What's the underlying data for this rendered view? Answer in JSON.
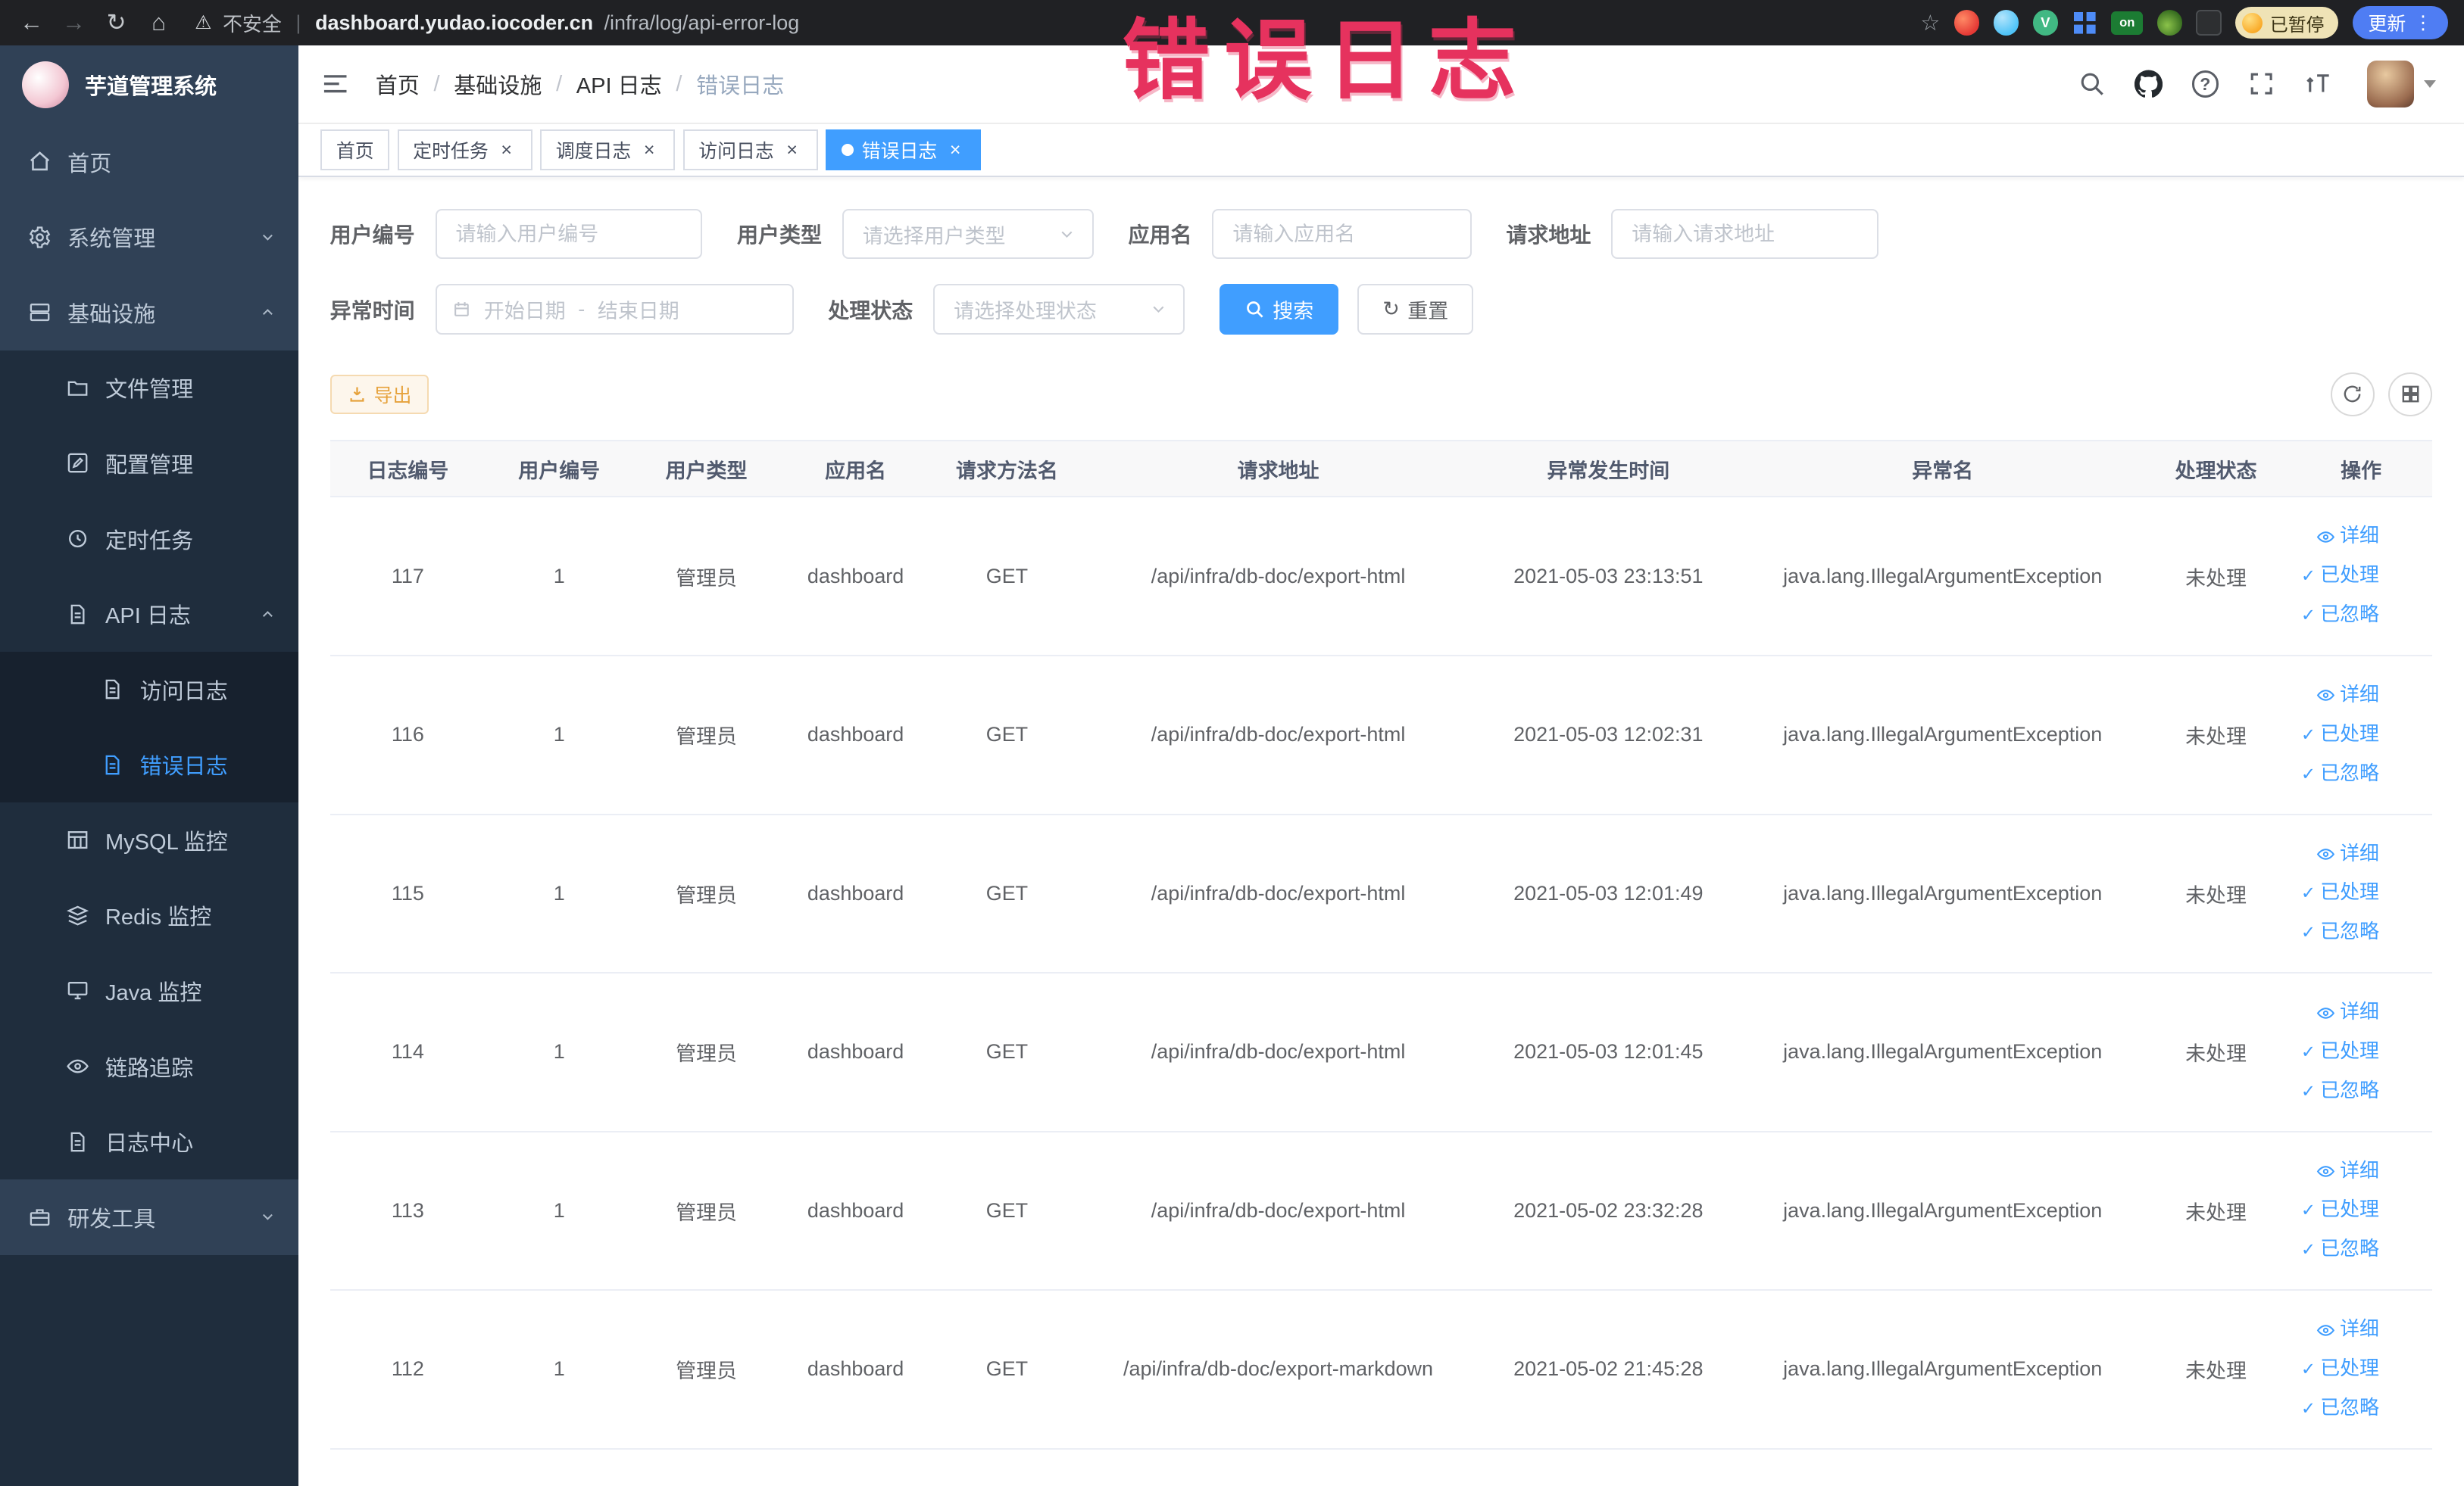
{
  "colors": {
    "accent": "#409eff",
    "sidebar_bg": "#304156",
    "sidebar_submenu_bg": "#1f2d3d",
    "annotation_red": "#e6325e",
    "active_tab_bg": "#409eff",
    "export_button_text": "#e6a23c",
    "export_button_bg": "#fdf6ec"
  },
  "annotation": {
    "text": "错误日志"
  },
  "glyphs": {
    "back": "←",
    "forward": "→",
    "reload": "↻",
    "home": "⌂",
    "warning": "⚠",
    "star": "☆",
    "kebab": "⋮",
    "check": "✓",
    "close": "×",
    "refresh": "↻",
    "question": "?",
    "vue": "V"
  },
  "browser": {
    "security_label": "不安全",
    "url_domain": "dashboard.yudao.iocoder.cn",
    "url_path": "/infra/log/api-error-log",
    "extension_on_badge": "on",
    "paused_badge": "已暂停",
    "update_button": "更新"
  },
  "sidebar": {
    "logo_title": "芋道管理系统",
    "items": {
      "home": "首页",
      "system": "系统管理",
      "infra": "基础设施",
      "file": "文件管理",
      "config": "配置管理",
      "job": "定时任务",
      "api_log": "API 日志",
      "access_log": "访问日志",
      "error_log": "错误日志",
      "mysql": "MySQL 监控",
      "redis": "Redis 监控",
      "java": "Java 监控",
      "trace": "链路追踪",
      "log_center": "日志中心",
      "dev_tools": "研发工具"
    }
  },
  "navbar": {
    "breadcrumb": [
      "首页",
      "基础设施",
      "API 日志",
      "错误日志"
    ],
    "separator": "/"
  },
  "tabs": [
    {
      "label": "首页"
    },
    {
      "label": "定时任务"
    },
    {
      "label": "调度日志"
    },
    {
      "label": "访问日志"
    },
    {
      "label": "错误日志"
    }
  ],
  "filters": {
    "user_id_label": "用户编号",
    "user_id_placeholder": "请输入用户编号",
    "user_type_label": "用户类型",
    "user_type_placeholder": "请选择用户类型",
    "app_name_label": "应用名",
    "app_name_placeholder": "请输入应用名",
    "request_url_label": "请求地址",
    "request_url_placeholder": "请输入请求地址",
    "exception_time_label": "异常时间",
    "date_start_placeholder": "开始日期",
    "date_separator": "-",
    "date_end_placeholder": "结束日期",
    "process_status_label": "处理状态",
    "process_status_placeholder": "请选择处理状态",
    "search_button": "搜索",
    "reset_button": "重置"
  },
  "toolbar": {
    "export_button": "导出"
  },
  "table": {
    "columns": [
      "日志编号",
      "用户编号",
      "用户类型",
      "应用名",
      "请求方法名",
      "请求地址",
      "异常发生时间",
      "异常名",
      "处理状态",
      "操作"
    ],
    "actions": {
      "detail": "详细",
      "processed": "已处理",
      "ignore": "已忽略"
    },
    "rows": [
      {
        "id": "117",
        "user_id": "1",
        "user_type": "管理员",
        "app_name": "dashboard",
        "method": "GET",
        "url": "/api/infra/db-doc/export-html",
        "time": "2021-05-03 23:13:51",
        "exception": "java.lang.IllegalArgumentException",
        "status": "未处理"
      },
      {
        "id": "116",
        "user_id": "1",
        "user_type": "管理员",
        "app_name": "dashboard",
        "method": "GET",
        "url": "/api/infra/db-doc/export-html",
        "time": "2021-05-03 12:02:31",
        "exception": "java.lang.IllegalArgumentException",
        "status": "未处理"
      },
      {
        "id": "115",
        "user_id": "1",
        "user_type": "管理员",
        "app_name": "dashboard",
        "method": "GET",
        "url": "/api/infra/db-doc/export-html",
        "time": "2021-05-03 12:01:49",
        "exception": "java.lang.IllegalArgumentException",
        "status": "未处理"
      },
      {
        "id": "114",
        "user_id": "1",
        "user_type": "管理员",
        "app_name": "dashboard",
        "method": "GET",
        "url": "/api/infra/db-doc/export-html",
        "time": "2021-05-03 12:01:45",
        "exception": "java.lang.IllegalArgumentException",
        "status": "未处理"
      },
      {
        "id": "113",
        "user_id": "1",
        "user_type": "管理员",
        "app_name": "dashboard",
        "method": "GET",
        "url": "/api/infra/db-doc/export-html",
        "time": "2021-05-02 23:32:28",
        "exception": "java.lang.IllegalArgumentException",
        "status": "未处理"
      },
      {
        "id": "112",
        "user_id": "1",
        "user_type": "管理员",
        "app_name": "dashboard",
        "method": "GET",
        "url": "/api/infra/db-doc/export-markdown",
        "time": "2021-05-02 21:45:28",
        "exception": "java.lang.IllegalArgumentException",
        "status": "未处理"
      }
    ]
  }
}
